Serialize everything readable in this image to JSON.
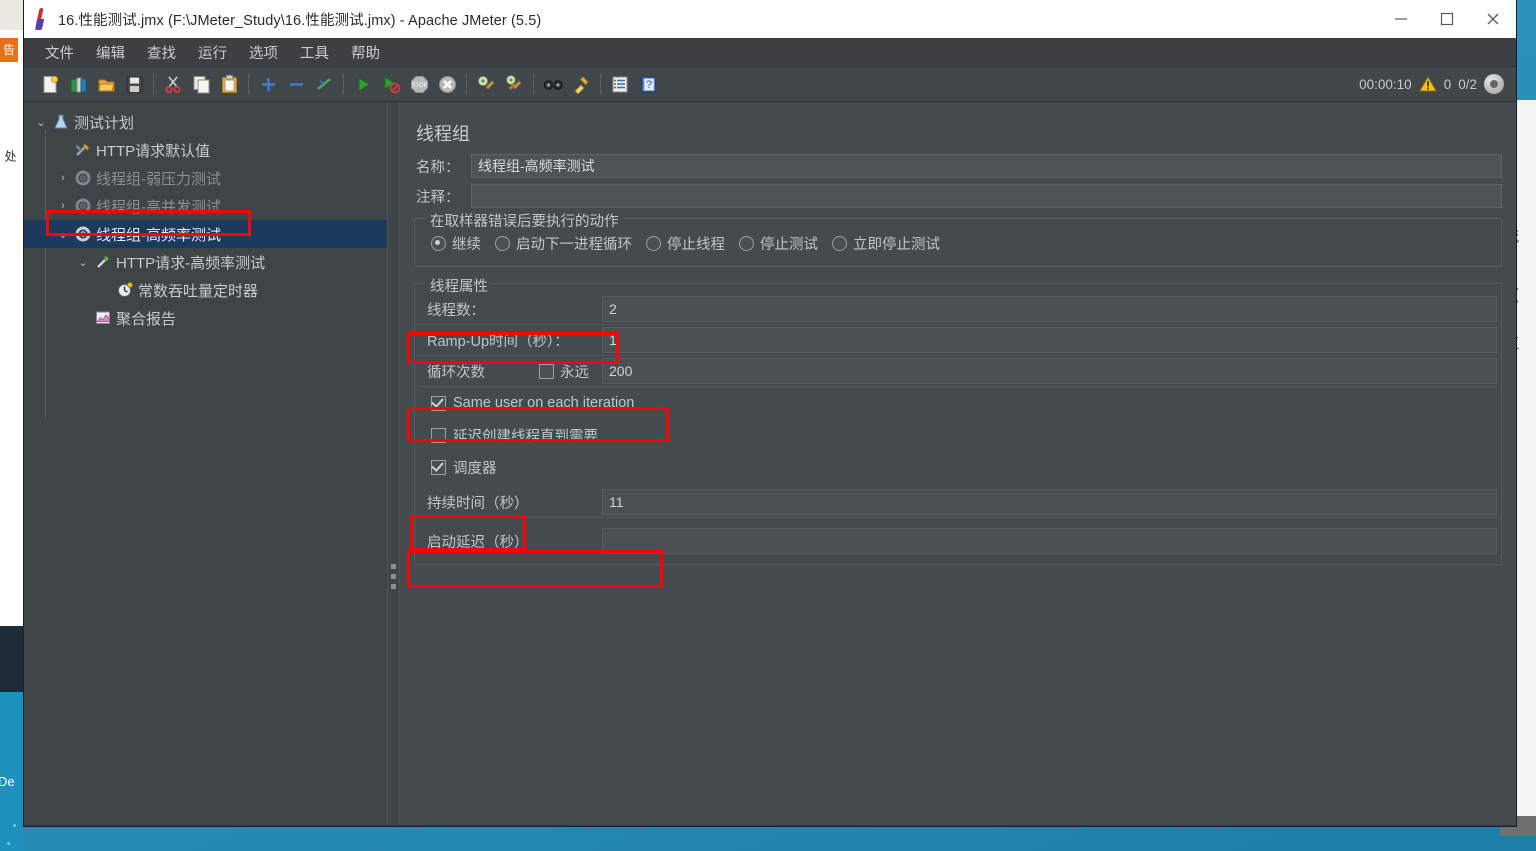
{
  "window": {
    "title": "16.性能测试.jmx (F:\\JMeter_Study\\16.性能测试.jmx) - Apache JMeter (5.5)",
    "app_icon": "jmeter-feather-icon",
    "minimize_label": "—",
    "maximize_label": "□",
    "close_label": "✕"
  },
  "menubar": {
    "items": [
      {
        "label": "文件",
        "name": "menu-file"
      },
      {
        "label": "编辑",
        "name": "menu-edit"
      },
      {
        "label": "查找",
        "name": "menu-search"
      },
      {
        "label": "运行",
        "name": "menu-run"
      },
      {
        "label": "选项",
        "name": "menu-options"
      },
      {
        "label": "工具",
        "name": "menu-tools"
      },
      {
        "label": "帮助",
        "name": "menu-help"
      }
    ]
  },
  "toolbar": {
    "buttons": [
      {
        "name": "new-icon",
        "title": "新建"
      },
      {
        "name": "templates-icon",
        "title": "模板"
      },
      {
        "name": "open-icon",
        "title": "打开"
      },
      {
        "name": "save-icon",
        "title": "保存"
      },
      {
        "name": "cut-icon",
        "title": "剪切"
      },
      {
        "name": "copy-icon",
        "title": "复制"
      },
      {
        "name": "paste-icon",
        "title": "粘贴"
      },
      {
        "name": "expand-all-icon",
        "title": "展开全部"
      },
      {
        "name": "collapse-all-icon",
        "title": "折叠全部"
      },
      {
        "name": "toggle-icon",
        "title": "启用/禁用"
      },
      {
        "name": "start-icon",
        "title": "启动"
      },
      {
        "name": "start-no-pause-icon",
        "title": "无停顿启动"
      },
      {
        "name": "stop-icon",
        "title": "停止"
      },
      {
        "name": "shutdown-icon",
        "title": "关闭"
      },
      {
        "name": "clear-icon",
        "title": "清除"
      },
      {
        "name": "clear-all-icon",
        "title": "清除全部"
      },
      {
        "name": "search-icon",
        "title": "查找"
      },
      {
        "name": "reset-search-icon",
        "title": "重置查找"
      },
      {
        "name": "function-helper-icon",
        "title": "函数助手"
      },
      {
        "name": "help-icon",
        "title": "帮助"
      }
    ],
    "status": {
      "elapsed": "00:00:10",
      "warning_count": "0",
      "threads": "0/2",
      "warning_icon": "warning-triangle-icon",
      "run-indicator": "run-indicator-icon"
    }
  },
  "tree": {
    "nodes": [
      {
        "label": "测试计划",
        "icon": "test-plan-icon",
        "twist": "v",
        "indent": 0,
        "state": "normal",
        "name": "tree-node-test-plan"
      },
      {
        "label": "HTTP请求默认值",
        "icon": "http-defaults-icon",
        "twist": "",
        "indent": 1,
        "state": "normal",
        "name": "tree-node-http-defaults"
      },
      {
        "label": "线程组-弱压力测试",
        "icon": "thread-group-icon",
        "twist": ">",
        "indent": 1,
        "state": "dim",
        "name": "tree-node-thread-group-weak"
      },
      {
        "label": "线程组-高并发测试",
        "icon": "thread-group-icon",
        "twist": ">",
        "indent": 1,
        "state": "dim",
        "name": "tree-node-thread-group-concurrent"
      },
      {
        "label": "线程组-高频率测试",
        "icon": "thread-group-icon",
        "twist": "v",
        "indent": 1,
        "state": "selected",
        "name": "tree-node-thread-group-highfreq"
      },
      {
        "label": "HTTP请求-高频率测试",
        "icon": "http-request-icon",
        "twist": "v",
        "indent": 2,
        "state": "normal",
        "name": "tree-node-http-request-highfreq"
      },
      {
        "label": "常数吞吐量定时器",
        "icon": "timer-icon",
        "twist": "",
        "indent": 3,
        "state": "normal",
        "name": "tree-node-constant-throughput-timer"
      },
      {
        "label": "聚合报告",
        "icon": "aggregate-report-icon",
        "twist": "",
        "indent": 2,
        "state": "normal",
        "name": "tree-node-aggregate-report"
      }
    ]
  },
  "main": {
    "panel_title": "线程组",
    "name_label": "名称：",
    "name_value": "线程组-高频率测试",
    "comment_label": "注释：",
    "comment_value": "",
    "action_group_title": "在取样器错误后要执行的动作",
    "actions": [
      {
        "label": "继续",
        "selected": true,
        "name": "radio-continue"
      },
      {
        "label": "启动下一进程循环",
        "selected": false,
        "name": "radio-start-next-loop"
      },
      {
        "label": "停止线程",
        "selected": false,
        "name": "radio-stop-thread"
      },
      {
        "label": "停止测试",
        "selected": false,
        "name": "radio-stop-test"
      },
      {
        "label": "立即停止测试",
        "selected": false,
        "name": "radio-stop-test-now"
      }
    ],
    "thread_props_title": "线程属性",
    "threads_label": "线程数：",
    "threads_value": "2",
    "rampup_label": "Ramp-Up时间（秒）：",
    "rampup_value": "1",
    "loops_label": "循环次数",
    "forever_label": "永远",
    "forever_checked": false,
    "loops_value": "200",
    "same_user_label": "Same user on each iteration",
    "same_user_checked": true,
    "delay_create_label": "延迟创建线程直到需要",
    "delay_create_checked": false,
    "scheduler_label": "调度器",
    "scheduler_checked": true,
    "duration_label": "持续时间（秒）",
    "duration_value": "11",
    "startup_delay_label": "启动延迟（秒）",
    "startup_delay_value": ""
  },
  "highlights": [
    {
      "name": "highlight-thread-group-node"
    },
    {
      "name": "highlight-threads-field"
    },
    {
      "name": "highlight-loops-field"
    },
    {
      "name": "highlight-scheduler-checkbox"
    },
    {
      "name": "highlight-duration-field"
    }
  ],
  "background": {
    "left_app_text": "处",
    "right_app_lines": [
      "0",
      "流",
      "（",
      "值",
      "-|"
    ],
    "desktop_label": "De"
  },
  "colors": {
    "accent_selection": "#1b3a5c",
    "highlight_red": "#ff0000",
    "panel_bg": "#454a4e",
    "window_bg": "#3f4447"
  }
}
